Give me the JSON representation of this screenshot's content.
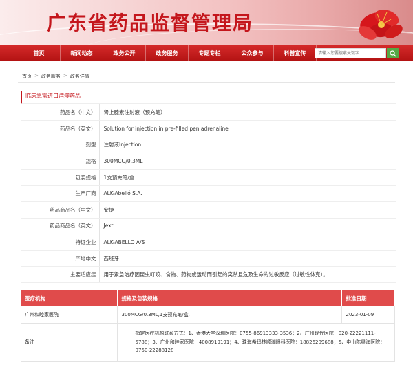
{
  "banner": {
    "title": "广东省药品监督管理局"
  },
  "nav": {
    "items": [
      "首页",
      "新闻动态",
      "政务公开",
      "政务服务",
      "专题专栏",
      "公众参与",
      "科普宣传"
    ],
    "search_placeholder": "请输入您要搜索关键字"
  },
  "breadcrumb": [
    "首页",
    "政务服务",
    "政务详情"
  ],
  "section_title": "临床急需进口港澳药品",
  "fields": [
    {
      "label": "药品名（中文）",
      "value": "肾上腺素注射液（预充笔）"
    },
    {
      "label": "药品名（英文）",
      "value": "Solution for injection in pre-filled pen adrenaline"
    },
    {
      "label": "剂型",
      "value": "注射液Injection"
    },
    {
      "label": "规格",
      "value": "300MCG/0.3ML"
    },
    {
      "label": "包装规格",
      "value": "1支预充笔/盒"
    },
    {
      "label": "生产厂商",
      "value": "ALK-Abelló S.A."
    },
    {
      "label": "药品商品名（中文）",
      "value": "安捷"
    },
    {
      "label": "药品商品名（英文）",
      "value": "Jext"
    },
    {
      "label": "持证企业",
      "value": "ALK-ABELLO A/S"
    },
    {
      "label": "产地中文",
      "value": "西班牙"
    },
    {
      "label": "主要适应症",
      "value": "用于紧急治疗因昆虫叮咬、食物、药物或运动而引起的突然且危及生命的过敏反应（过敏性休克）。"
    }
  ],
  "hospital_table": {
    "headers": [
      "医疗机构",
      "规格及包装规格",
      "批准日期"
    ],
    "rows": [
      [
        "广州和睦家医院",
        "300MCG/0.3ML,1支预充笔/盒.",
        "2023-01-09"
      ]
    ],
    "note_label": "备注",
    "note_value": "指定医疗机构联系方式：1、香港大学深圳医院：0755-86913333-3536；2、广州现代医院：020-22221111-5788；3、广州和睦家医院：4008919191；4、珠海希玛林顺潮眼科医院：18826209688；5、中山陈星海医院：0760-22288128"
  },
  "colors": {
    "accent": "#c4161c",
    "nav": "#c21b1b",
    "table_header": "#e04b4b",
    "search_button": "#55a845"
  }
}
